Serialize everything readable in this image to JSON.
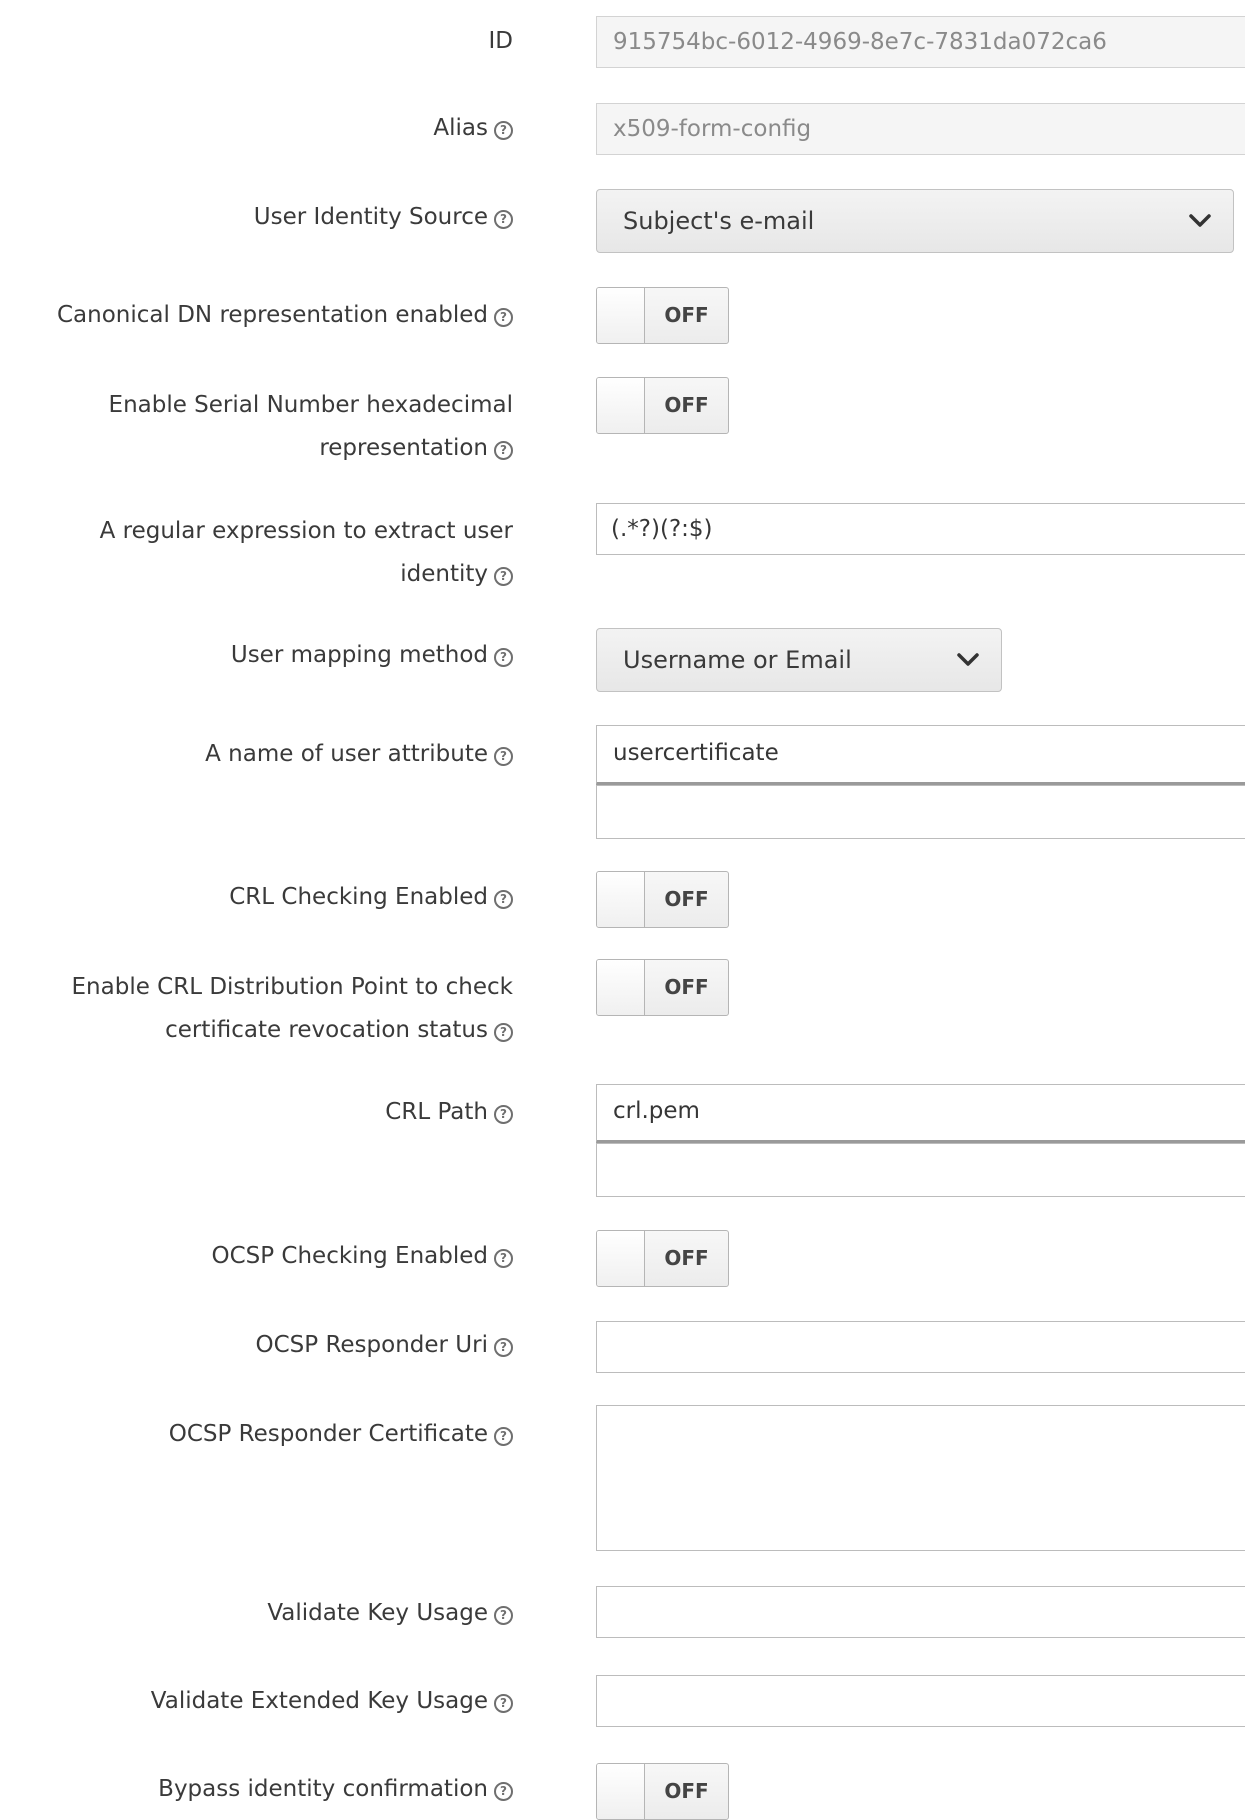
{
  "fields": {
    "id": {
      "label": "ID",
      "value": "915754bc-6012-4969-8e7c-7831da072ca6"
    },
    "alias": {
      "label": "Alias",
      "value": "x509-form-config"
    },
    "user_identity_source": {
      "label": "User Identity Source",
      "value": "Subject's e-mail"
    },
    "canonical_dn": {
      "label": "Canonical DN representation enabled",
      "state": "OFF"
    },
    "serial_hex": {
      "label_line1": "Enable Serial Number hexadecimal",
      "label_line2": "representation",
      "state": "OFF"
    },
    "regex": {
      "label_line1": "A regular expression to extract user",
      "label_line2": "identity",
      "value": "(.*?)(?:$)"
    },
    "user_mapping_method": {
      "label": "User mapping method",
      "value": "Username or Email"
    },
    "user_attribute": {
      "label": "A name of user attribute",
      "value": "usercertificate"
    },
    "crl_checking": {
      "label": "CRL Checking Enabled",
      "state": "OFF"
    },
    "crl_distribution": {
      "label_line1": "Enable CRL Distribution Point to check",
      "label_line2": "certificate revocation status",
      "state": "OFF"
    },
    "crl_path": {
      "label": "CRL Path",
      "value": "crl.pem"
    },
    "ocsp_checking": {
      "label": "OCSP Checking Enabled",
      "state": "OFF"
    },
    "ocsp_responder_uri": {
      "label": "OCSP Responder Uri",
      "value": ""
    },
    "ocsp_responder_cert": {
      "label": "OCSP Responder Certificate",
      "value": ""
    },
    "validate_key_usage": {
      "label": "Validate Key Usage",
      "value": ""
    },
    "validate_ext_key_usage": {
      "label": "Validate Extended Key Usage",
      "value": ""
    },
    "bypass_identity": {
      "label": "Bypass identity confirmation",
      "state": "OFF"
    }
  },
  "help_icon_glyph": "?",
  "icons": {
    "help": "question-circle-icon",
    "dropdown": "chevron-down-icon"
  }
}
